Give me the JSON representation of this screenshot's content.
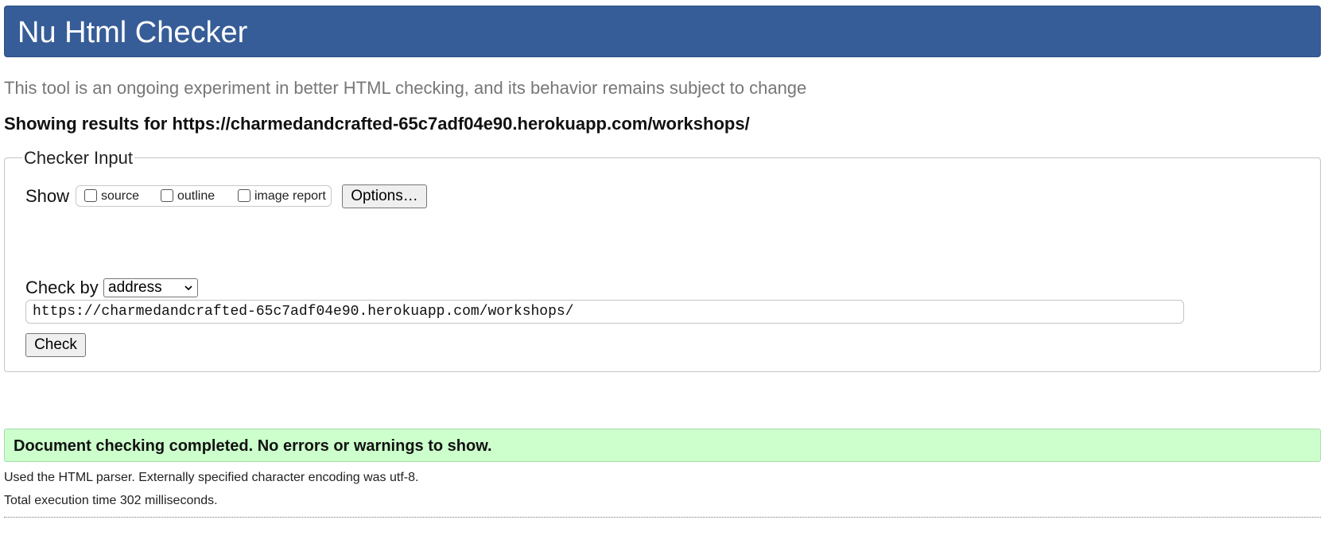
{
  "header": {
    "title": "Nu Html Checker"
  },
  "intro": {
    "subtitle": "This tool is an ongoing experiment in better HTML checking, and its behavior remains subject to change",
    "results_for": "Showing results for https://charmedandcrafted-65c7adf04e90.herokuapp.com/workshops/"
  },
  "checker_input": {
    "legend": "Checker Input",
    "show_label": "Show",
    "checkboxes": [
      {
        "label": "source",
        "checked": false
      },
      {
        "label": "outline",
        "checked": false
      },
      {
        "label": "image report",
        "checked": false
      }
    ],
    "options_button": "Options…",
    "check_by_label": "Check by",
    "check_by_selected": "address",
    "url_value": "https://charmedandcrafted-65c7adf04e90.herokuapp.com/workshops/",
    "check_button": "Check"
  },
  "results": {
    "success_message": "Document checking completed. No errors or warnings to show.",
    "parser_info": "Used the HTML parser. Externally specified character encoding was utf-8.",
    "execution_time": "Total execution time 302 milliseconds."
  },
  "colors": {
    "header_bg": "#365d98",
    "success_bg": "#ccffcc",
    "subtitle_text": "#777777"
  },
  "icons": {
    "select_chevron": "chevron-down-icon"
  }
}
